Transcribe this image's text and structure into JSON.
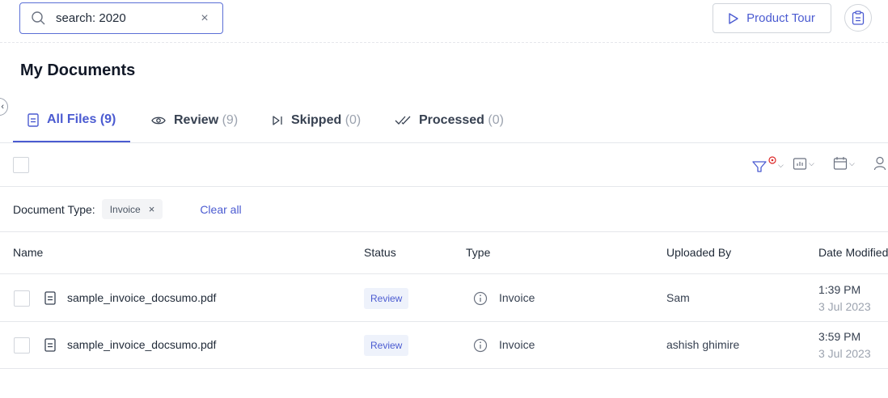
{
  "search": {
    "value": "search: 2020",
    "clear": "×"
  },
  "header": {
    "product_tour_label": "Product Tour"
  },
  "page": {
    "title": "My Documents"
  },
  "tabs": [
    {
      "label": "All Files",
      "count": "(9)",
      "icon": "file-text-icon",
      "active": true
    },
    {
      "label": "Review",
      "count": "(9)",
      "icon": "eye-icon",
      "active": false
    },
    {
      "label": "Skipped",
      "count": "(0)",
      "icon": "skip-icon",
      "active": false
    },
    {
      "label": "Processed",
      "count": "(0)",
      "icon": "double-check-icon",
      "active": false
    }
  ],
  "toolbar": {
    "tools": [
      "filter-icon",
      "chart-icon",
      "calendar-icon",
      "user-icon"
    ]
  },
  "filters": {
    "label": "Document Type:",
    "chip": "Invoice",
    "chip_remove": "×",
    "clear_all": "Clear all"
  },
  "table": {
    "columns": [
      "Name",
      "Status",
      "Type",
      "Uploaded By",
      "Date Modified"
    ],
    "rows": [
      {
        "name": "sample_invoice_docsumo.pdf",
        "status": "Review",
        "type": "Invoice",
        "uploaded_by": "Sam",
        "time": "1:39 PM",
        "date": "3 Jul 2023"
      },
      {
        "name": "sample_invoice_docsumo.pdf",
        "status": "Review",
        "type": "Invoice",
        "uploaded_by": "ashish ghimire",
        "time": "3:59 PM",
        "date": "3 Jul 2023"
      }
    ]
  },
  "colors": {
    "accent": "#4b5bd1",
    "badge_bg": "#eef2fb",
    "filter_alert": "#dc2626"
  }
}
